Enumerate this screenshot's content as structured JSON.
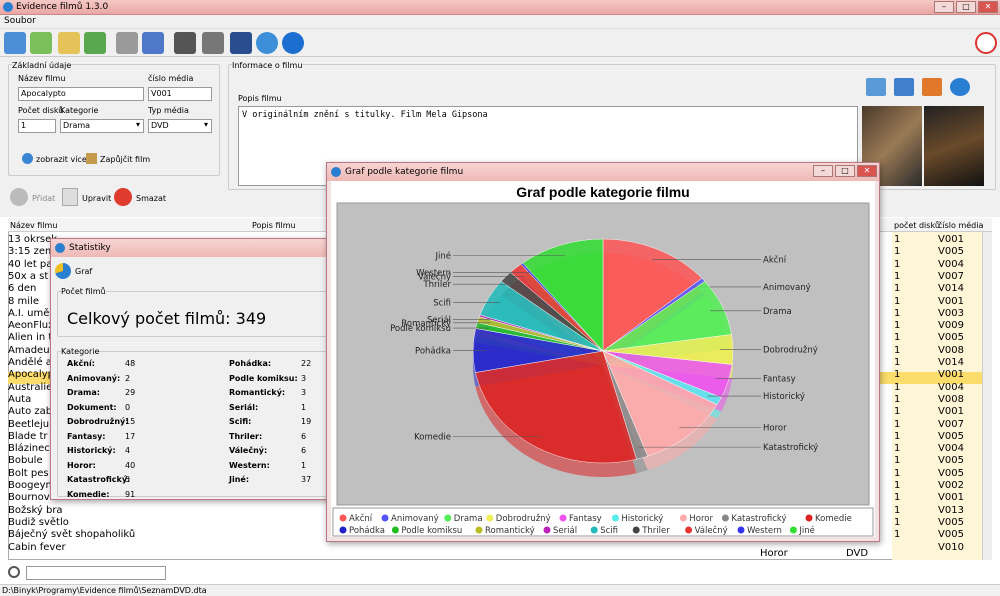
{
  "app": {
    "title": "Evidence filmů 1.3.0",
    "menu": "Soubor",
    "status_path": "D:\\Binyk\\Programy\\Evidence filmů\\SeznamDVD.dta"
  },
  "basic": {
    "legend": "Základní údaje",
    "name_label": "Název filmu",
    "name_value": "Apocalypto",
    "media_no_label": "číslo média",
    "media_no_value": "V001",
    "discs_label": "Počet disků",
    "discs_value": "1",
    "category_label": "Kategorie",
    "category_value": "Drama",
    "media_type_label": "Typ média",
    "media_type_value": "DVD",
    "show_more": "zobrazit více",
    "borrow": "Zapůjčit film"
  },
  "info": {
    "legend": "Informace o filmu",
    "desc_label": "Popis filmu",
    "desc_value": "V originálním znění s titulky. Film Mela Gipsona"
  },
  "actions": {
    "add": "Přidat",
    "edit": "Upravit",
    "delete": "Smazat"
  },
  "table": {
    "col_name": "Název filmu",
    "col_desc": "Popis filmu",
    "col_discs": "počet disků",
    "col_media": "číslo média",
    "names": [
      "13 okrsek",
      "3:15 zem",
      "40 let pa",
      "50x a st",
      "6 den",
      "8 mile",
      "A.I. umě",
      "AeonFlux",
      "Alien in t",
      "Amadeus",
      "Andělé a",
      "Apocalyp",
      "Australie",
      "Auta",
      "Auto zab",
      "Beetleju",
      "Blade tr",
      "Blázinec",
      "Bobule",
      "Bolt pes",
      "Boogeym",
      "Bournov",
      "Božský bra",
      "Budiž světlo",
      "Báječný svět shopaholiků",
      "Cabin fever"
    ],
    "discs": [
      "1",
      "1",
      "1",
      "1",
      "1",
      "1",
      "1",
      "1",
      "1",
      "1",
      "1",
      "1",
      "1",
      "1",
      "1",
      "1",
      "1",
      "1",
      "1",
      "1",
      "1",
      "1",
      "1",
      "1",
      "1"
    ],
    "media": [
      "V001",
      "V005",
      "V004",
      "V007",
      "V014",
      "V001",
      "V003",
      "V009",
      "V005",
      "V008",
      "V014",
      "V001",
      "V004",
      "V008",
      "V001",
      "V007",
      "V005",
      "V004",
      "V005",
      "V005",
      "V002",
      "V001",
      "V013",
      "V005",
      "V005",
      "V010"
    ],
    "last_genre": "Horor",
    "last_type": "DVD"
  },
  "stats": {
    "title": "Statistiky",
    "graph_btn": "Graf",
    "count_legend": "Počet filmů",
    "total": "Celkový počet filmů: 349",
    "cat_legend": "Kategorie",
    "left": [
      [
        "Akční:",
        "48"
      ],
      [
        "Animovaný:",
        "2"
      ],
      [
        "Drama:",
        "29"
      ],
      [
        "Dokument:",
        "0"
      ],
      [
        "Dobrodružný:",
        "15"
      ],
      [
        "Fantasy:",
        "17"
      ],
      [
        "Historický:",
        "4"
      ],
      [
        "Horor:",
        "40"
      ],
      [
        "Katastrofický:",
        "5"
      ],
      [
        "Komedie:",
        "91"
      ]
    ],
    "right": [
      [
        "Pohádka:",
        "22"
      ],
      [
        "Podle komiksu:",
        "3"
      ],
      [
        "Romantický:",
        "3"
      ],
      [
        "Seriál:",
        "1"
      ],
      [
        "Scifi:",
        "19"
      ],
      [
        "Thriler:",
        "6"
      ],
      [
        "Válečný:",
        "6"
      ],
      [
        "Western:",
        "1"
      ],
      [
        "Jiné:",
        "37"
      ]
    ]
  },
  "graph_window": {
    "title": "Graf podle kategorie filmu"
  },
  "chart_data": {
    "type": "pie",
    "title": "Graf podle kategorie filmu",
    "categories": [
      "Akční",
      "Animovaný",
      "Drama",
      "Dobrodružný",
      "Fantasy",
      "Historický",
      "Horor",
      "Katastrofický",
      "Komedie",
      "Pohádka",
      "Podle komiksu",
      "Romantický",
      "Seriál",
      "Scifi",
      "Thriler",
      "Válečný",
      "Western",
      "Jiné"
    ],
    "values": [
      48,
      2,
      29,
      15,
      17,
      4,
      40,
      5,
      91,
      22,
      3,
      3,
      1,
      19,
      6,
      6,
      1,
      37
    ],
    "colors": [
      "#ff5555",
      "#5555ff",
      "#55ee55",
      "#eeee55",
      "#ee55ee",
      "#55eeee",
      "#ffaaaa",
      "#888888",
      "#dd2222",
      "#2222cc",
      "#22bb22",
      "#bbbb22",
      "#bb22bb",
      "#22bbbb",
      "#444444",
      "#ee3333",
      "#3333ee",
      "#33dd33"
    ],
    "legend": "bottom"
  }
}
